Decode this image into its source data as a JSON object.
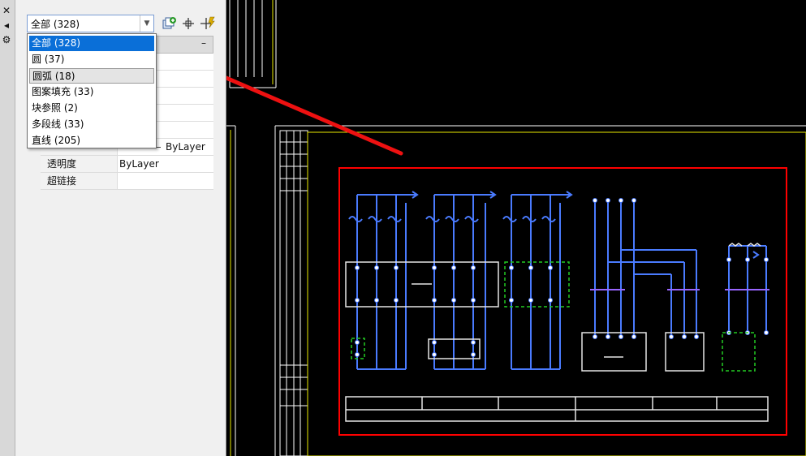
{
  "selector": {
    "value": "全部 (328)"
  },
  "dropdown_options": [
    {
      "label": "全部 (328)"
    },
    {
      "label": "圆 (37)"
    },
    {
      "label": "圆弧 (18)"
    },
    {
      "label": "图案填充 (33)"
    },
    {
      "label": "块参照 (2)"
    },
    {
      "label": "多段线 (33)"
    },
    {
      "label": "直线 (205)"
    }
  ],
  "properties": [
    {
      "label": "透明度",
      "value": "ByLayer"
    },
    {
      "label": "超链接",
      "value": ""
    }
  ],
  "partial_value": "ByLayer",
  "colors": {
    "selected": "#0a6fd8",
    "wire": "#3c6cff",
    "frame": "#e8e800",
    "highlight": "#ff0000",
    "arrow": "#ee1111",
    "dashed": "#22cc22"
  }
}
